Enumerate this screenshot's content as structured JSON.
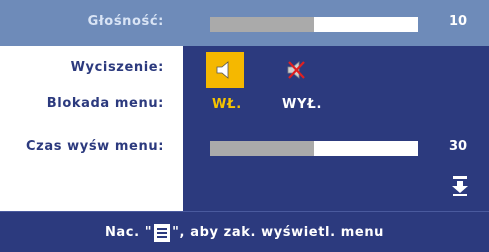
{
  "volume": {
    "label": "Głośność:",
    "value": "10",
    "level": 0.5
  },
  "mute": {
    "label": "Wyciszenie:",
    "options": [
      {
        "icon": "speaker-icon",
        "selected": true
      },
      {
        "icon": "speaker-muted-icon",
        "selected": false
      }
    ]
  },
  "menu_lock": {
    "label": "Blokada menu:",
    "on_label": "WŁ.",
    "off_label": "WYŁ.",
    "selected": "on"
  },
  "menu_timeout": {
    "label": "Czas wyśw menu:",
    "value": "30",
    "level": 0.5
  },
  "scroll": {
    "icon": "down-arrow-icon"
  },
  "footer": {
    "prefix": "Nac. \"",
    "icon": "menu-button-icon",
    "suffix": "\", aby zak. wyświetl. menu"
  },
  "colors": {
    "background": "#2c3a7e",
    "highlight": "#6e8bb9",
    "selected": "#f5b800",
    "bar_fill": "#aaaaaa",
    "bar_track": "#ffffff"
  }
}
